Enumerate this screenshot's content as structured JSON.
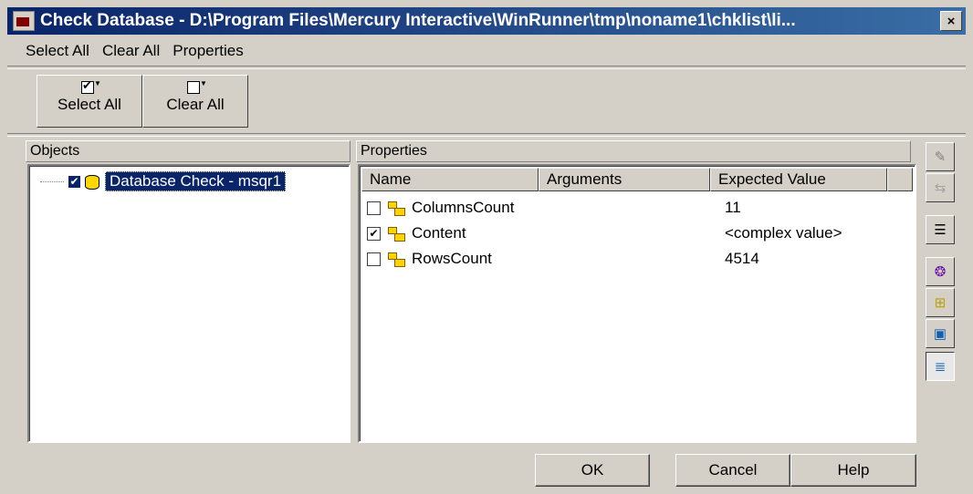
{
  "window": {
    "title": "Check Database - D:\\Program Files\\Mercury Interactive\\WinRunner\\tmp\\noname1\\chklist\\li...",
    "close_label": "×"
  },
  "menu": {
    "items": [
      "Select All",
      "Clear All",
      "Properties"
    ]
  },
  "toolbar": {
    "select_all_label": "Select All",
    "clear_all_label": "Clear All"
  },
  "objects_panel": {
    "header": "Objects",
    "tree": [
      {
        "label": "Database Check - msqr1",
        "checked": true,
        "icon": "database-icon"
      }
    ]
  },
  "properties_panel": {
    "header": "Properties",
    "columns": [
      "Name",
      "Arguments",
      "Expected Value"
    ],
    "rows": [
      {
        "name": "ColumnsCount",
        "arguments": "",
        "expected": "11",
        "checked": false
      },
      {
        "name": "Content",
        "arguments": "",
        "expected": "<complex value>",
        "checked": true
      },
      {
        "name": "RowsCount",
        "arguments": "",
        "expected": "4514",
        "checked": false
      }
    ]
  },
  "side_toolbar": {
    "icons": [
      "edit-expected-icon",
      "compare-icon",
      "checklist-icon",
      "standard-properties-icon",
      "all-properties-icon",
      "export-icon",
      "list-view-icon"
    ],
    "glyphs": [
      "✎",
      "⇆",
      "☰",
      "❂",
      "⊞",
      "▣",
      "≣"
    ]
  },
  "buttons": {
    "ok": "OK",
    "cancel": "Cancel",
    "help": "Help"
  },
  "colors": {
    "titlebar": "#0a246a",
    "face": "#d4d0c8",
    "selection": "#0a246a"
  }
}
